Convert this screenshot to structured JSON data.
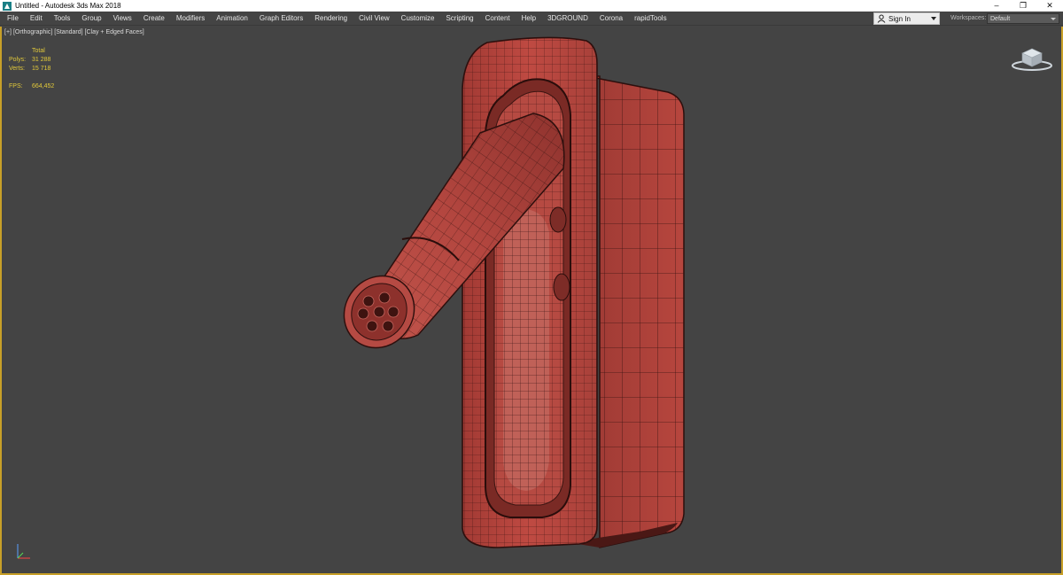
{
  "window": {
    "title": "Untitled - Autodesk 3ds Max 2018",
    "minimize": "–",
    "maximize": "❐",
    "close": "✕"
  },
  "menu": {
    "items": [
      "File",
      "Edit",
      "Tools",
      "Group",
      "Views",
      "Create",
      "Modifiers",
      "Animation",
      "Graph Editors",
      "Rendering",
      "Civil View",
      "Customize",
      "Scripting",
      "Content",
      "Help",
      "3DGROUND",
      "Corona",
      "rapidTools"
    ]
  },
  "account": {
    "signin_label": "Sign In",
    "workspaces_label": "Workspaces:",
    "workspace_value": "Default"
  },
  "viewport": {
    "label_plus": "[+]",
    "label_view": "[Orthographic]",
    "label_shading": "[Standard]",
    "label_mode": "[Clay + Edged Faces]",
    "stats": {
      "header": "Total",
      "polys_label": "Polys:",
      "polys_value": "31 288",
      "verts_label": "Verts:",
      "verts_value": "15 718",
      "fps_label": "FPS:",
      "fps_value": "664,452"
    }
  },
  "colors": {
    "accent_border": "#c8a028",
    "model_fill": "#b5413a",
    "viewport_bg": "#444444",
    "stats_text": "#e2c93a"
  }
}
